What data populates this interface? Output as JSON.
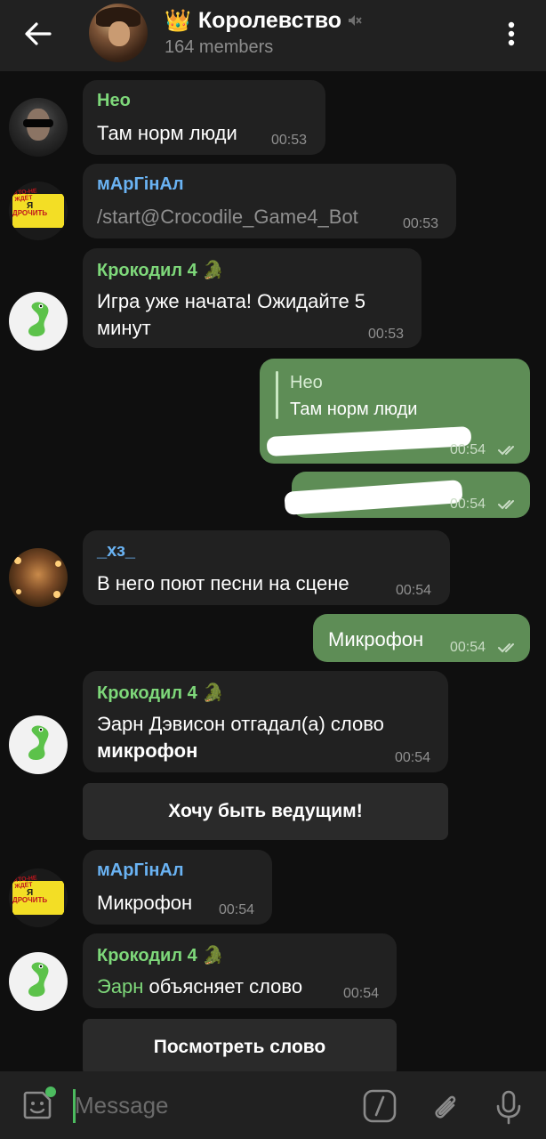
{
  "header": {
    "back_icon": "arrow-left-icon",
    "crown_emoji": "👑",
    "title": "Королевство",
    "muted_icon": "muted-speaker-icon",
    "subtitle": "164 members",
    "menu_icon": "more-vertical-icon"
  },
  "messages": [
    {
      "sender": "Нео",
      "sender_color": "#7ed87a",
      "text": "Там норм люди",
      "time": "00:53"
    },
    {
      "sender": "мАрГінАл",
      "sender_color": "#6ab3f3",
      "text": "/start@Crocodile_Game4_Bot",
      "time": "00:53"
    },
    {
      "sender": "Крокодил 4 🐊",
      "sender_color": "#7ed87a",
      "text_lines": [
        "Игра уже начата! Ожидайте 5",
        "минут"
      ],
      "time": "00:53"
    },
    {
      "reply_name": "Нео",
      "reply_text": "Там норм люди",
      "time": "00:54"
    },
    {
      "time": "00:54"
    },
    {
      "sender": "_хз_",
      "sender_color": "#6ab3f3",
      "text": "В него поют песни на сцене",
      "time": "00:54"
    },
    {
      "text": "Микрофон",
      "time": "00:54"
    },
    {
      "sender": "Крокодил 4 🐊",
      "sender_color": "#7ed87a",
      "text_line1": "Эарн Дэвисон отгадал(а) слово",
      "text_bold": "микрофон",
      "time": "00:54"
    },
    {
      "button": "Хочу быть ведущим!"
    },
    {
      "sender": "мАрГінАл",
      "sender_color": "#6ab3f3",
      "text": "Микрофон",
      "time": "00:54"
    },
    {
      "sender": "Крокодил 4 🐊",
      "sender_color": "#7ed87a",
      "mention": "Эарн",
      "text": " объясняет слово",
      "time": "00:54"
    },
    {
      "button": "Посмотреть слово"
    }
  ],
  "avatars": {
    "marg_sign_top": "КТО-НЕ ЖДЁТ",
    "marg_sign_mid": "Я",
    "marg_sign_bottom": "ДРОЧИТЬ"
  },
  "composer": {
    "placeholder": "Message",
    "emoji_icon": "sticker-smile-icon",
    "command_icon": "slash-command-icon",
    "attach_icon": "paperclip-icon",
    "mic_icon": "microphone-icon"
  },
  "colors": {
    "background": "#0f0f0f",
    "incoming_bubble": "#212121",
    "outgoing_bubble": "#5e8d56",
    "accent_green": "#4cbb5f",
    "crocodile_name": "#7ed87a",
    "link_blue": "#6ab3f3"
  }
}
